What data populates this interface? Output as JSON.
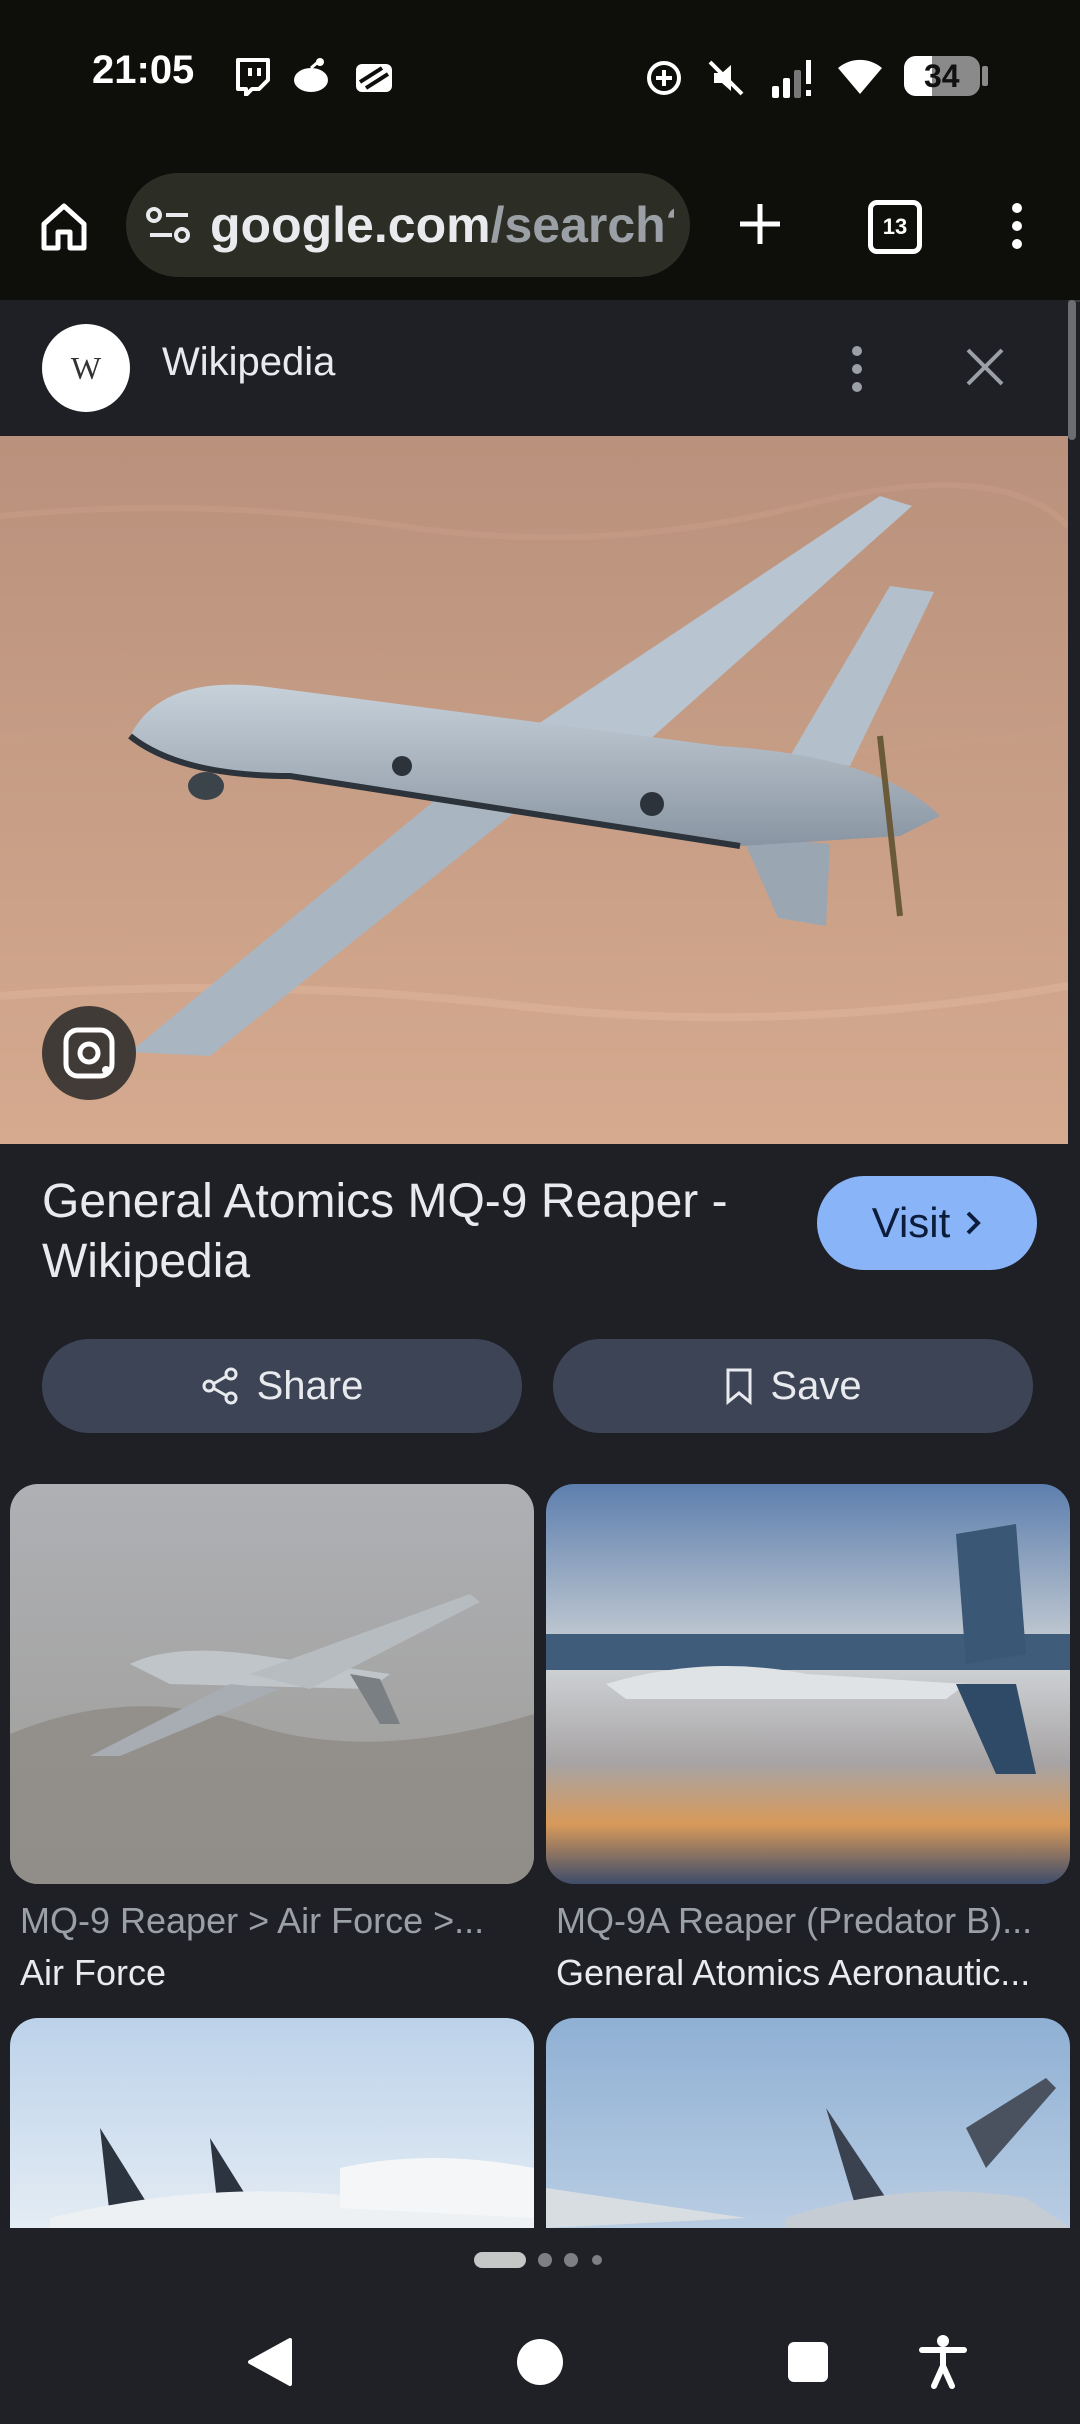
{
  "status_bar": {
    "time": "21:05",
    "battery": "34",
    "icons": [
      "twitch-icon",
      "reddit-icon",
      "stack-icon",
      "data-saver-icon",
      "mute-icon",
      "signal-icon",
      "wifi-icon",
      "battery-icon"
    ]
  },
  "toolbar": {
    "url_host": "google.com",
    "url_path": "/search?",
    "tab_count": "13"
  },
  "panel": {
    "source_name": "Wikipedia",
    "logo_text": "W"
  },
  "result": {
    "title": "General Atomics MQ-9 Reaper - Wikipedia",
    "visit_label": "Visit",
    "share_label": "Share",
    "save_label": "Save"
  },
  "related": [
    {
      "title": "MQ-9 Reaper > Air Force >...",
      "source": "Air Force"
    },
    {
      "title": "MQ-9A Reaper (Predator B)...",
      "source": "General Atomics Aeronautic..."
    }
  ],
  "colors": {
    "accent": "#8ab4f8",
    "pill": "#3c4456",
    "background": "#1f2026"
  }
}
